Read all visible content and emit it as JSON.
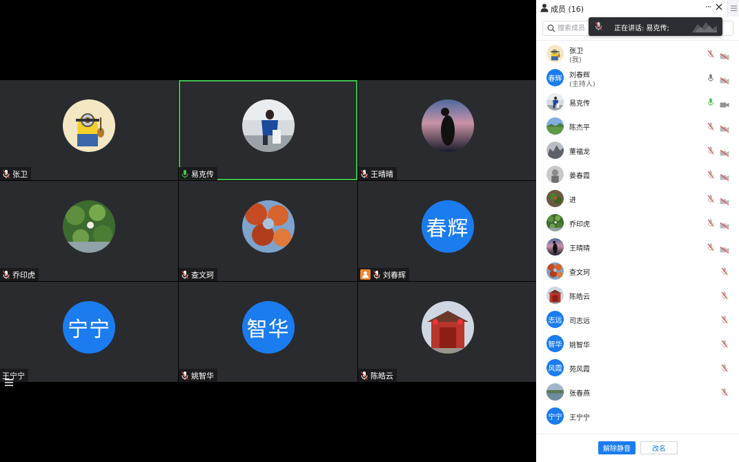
{
  "panel": {
    "title": "成员 (16)",
    "more_label": "···",
    "search_placeholder": "搜索成员"
  },
  "toast": {
    "text": "正在讲话: 易克传;"
  },
  "tiles": [
    {
      "name": "张卫",
      "mic": "muted",
      "avatar": "minion"
    },
    {
      "name": "易克传",
      "mic": "active",
      "avatar": "photo-person",
      "speaking": true
    },
    {
      "name": "王晴晴",
      "mic": "muted",
      "avatar": "photo-sunset"
    },
    {
      "name": "乔印虎",
      "mic": "muted",
      "avatar": "photo-lotus"
    },
    {
      "name": "查文珂",
      "mic": "muted",
      "avatar": "photo-autumn"
    },
    {
      "name": "刘春辉",
      "mic": "muted",
      "avatar_text": "春辉",
      "host": true
    },
    {
      "name": "王宁宁",
      "mic": "none",
      "avatar_text": "宁宁"
    },
    {
      "name": "姚智华",
      "mic": "muted",
      "avatar_text": "智华"
    },
    {
      "name": "陈皓云",
      "mic": "muted",
      "avatar": "photo-gate"
    }
  ],
  "members": [
    {
      "name": "张卫",
      "sub": "(我)",
      "mic": "muted",
      "cam": "off",
      "avatar": "minion"
    },
    {
      "name": "刘春辉",
      "sub": "(主持人)",
      "mic": "on",
      "cam": "off",
      "avatar_text": "春辉"
    },
    {
      "name": "易克传",
      "mic": "active",
      "cam": "on",
      "avatar": "photo-person"
    },
    {
      "name": "陈杰平",
      "mic": "muted",
      "cam": "off",
      "avatar": "photo-landscape"
    },
    {
      "name": "董福龙",
      "mic": "muted",
      "cam": "off",
      "avatar": "photo-rock"
    },
    {
      "name": "姜春霞",
      "mic": "muted",
      "cam": "off",
      "avatar": "photo-grey"
    },
    {
      "name": "进",
      "mic": "muted",
      "cam": "off",
      "avatar": "photo-plant"
    },
    {
      "name": "乔印虎",
      "mic": "muted",
      "cam": "off",
      "avatar": "photo-lotus"
    },
    {
      "name": "王晴晴",
      "mic": "muted",
      "cam": "off",
      "avatar": "photo-sunset"
    },
    {
      "name": "查文珂",
      "mic": "muted",
      "cam": "none",
      "avatar": "photo-autumn"
    },
    {
      "name": "陈皓云",
      "mic": "muted",
      "cam": "none",
      "avatar": "photo-gate"
    },
    {
      "name": "司志远",
      "mic": "muted",
      "cam": "none",
      "avatar_text": "志远"
    },
    {
      "name": "姚智华",
      "mic": "muted",
      "cam": "none",
      "avatar_text": "智华"
    },
    {
      "name": "苑风霞",
      "mic": "muted",
      "cam": "none",
      "avatar_text": "风霞"
    },
    {
      "name": "张春燕",
      "mic": "muted",
      "cam": "none",
      "avatar": "photo-lake"
    },
    {
      "name": "王宁宁",
      "mic": "none",
      "cam": "none",
      "avatar_text": "宁宁"
    }
  ],
  "footer": {
    "unmute_label": "解除静音",
    "rename_label": "改名"
  },
  "colors": {
    "accent": "#1b7cf0",
    "speaking_green": "#3ec250",
    "muted_red": "#e0463c",
    "host_orange": "#f0862d"
  }
}
